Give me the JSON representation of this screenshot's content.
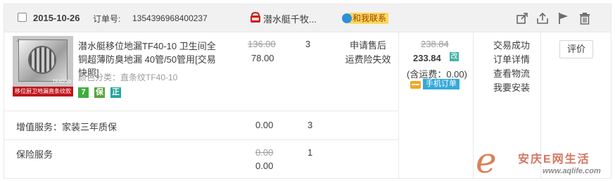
{
  "order": {
    "date": "2015-10-26",
    "order_number_label": "订单号:",
    "order_number": "1354396968400237",
    "shop_name": "潜水艇千牧...",
    "contact_label": "和我联系",
    "header_icons": [
      "share-icon",
      "upload-icon",
      "flag-icon",
      "trash-icon"
    ]
  },
  "product": {
    "title": "潜水艇移位地漏TF40-10 卫生间全铜超薄防臭地漏 40管/50管用[交易快照]",
    "color_label": "颜色分类：直条纹TF40-10",
    "image_banner": "移位厨卫地漏直条纹款",
    "image_model": "TF40-10",
    "badges": [
      "7",
      "保",
      "正"
    ],
    "original_price": "136.00",
    "price": "78.00",
    "quantity": "3",
    "service_lines": [
      "申请售后",
      "运费险失效"
    ]
  },
  "totals": {
    "original_total": "238.84",
    "total": "233.84",
    "changed_badge": "改",
    "shipping_note": "(含运费：0.00)",
    "mobile_order_label": "手机订单"
  },
  "status": {
    "lines": [
      "交易成功",
      "订单详情",
      "查看物流",
      "我要安装"
    ]
  },
  "actions": {
    "rate_label": "评价"
  },
  "extra_rows": [
    {
      "label": "增值服务：家装三年质保",
      "price": "0.00",
      "quantity": "3"
    },
    {
      "label": "保险服务",
      "original_price": "0.00",
      "price": "0.00",
      "quantity": "1"
    }
  ],
  "watermark": {
    "letter": "e",
    "brand": "安庆E网生活",
    "url": "www.aqlife.com"
  },
  "colors": {
    "header_bg": "#f1f1f1",
    "border": "#e8e8e8",
    "contact_bg": "#fad95c",
    "mobile_bg": "#34a9d9",
    "banner_red": "#c0151b"
  }
}
